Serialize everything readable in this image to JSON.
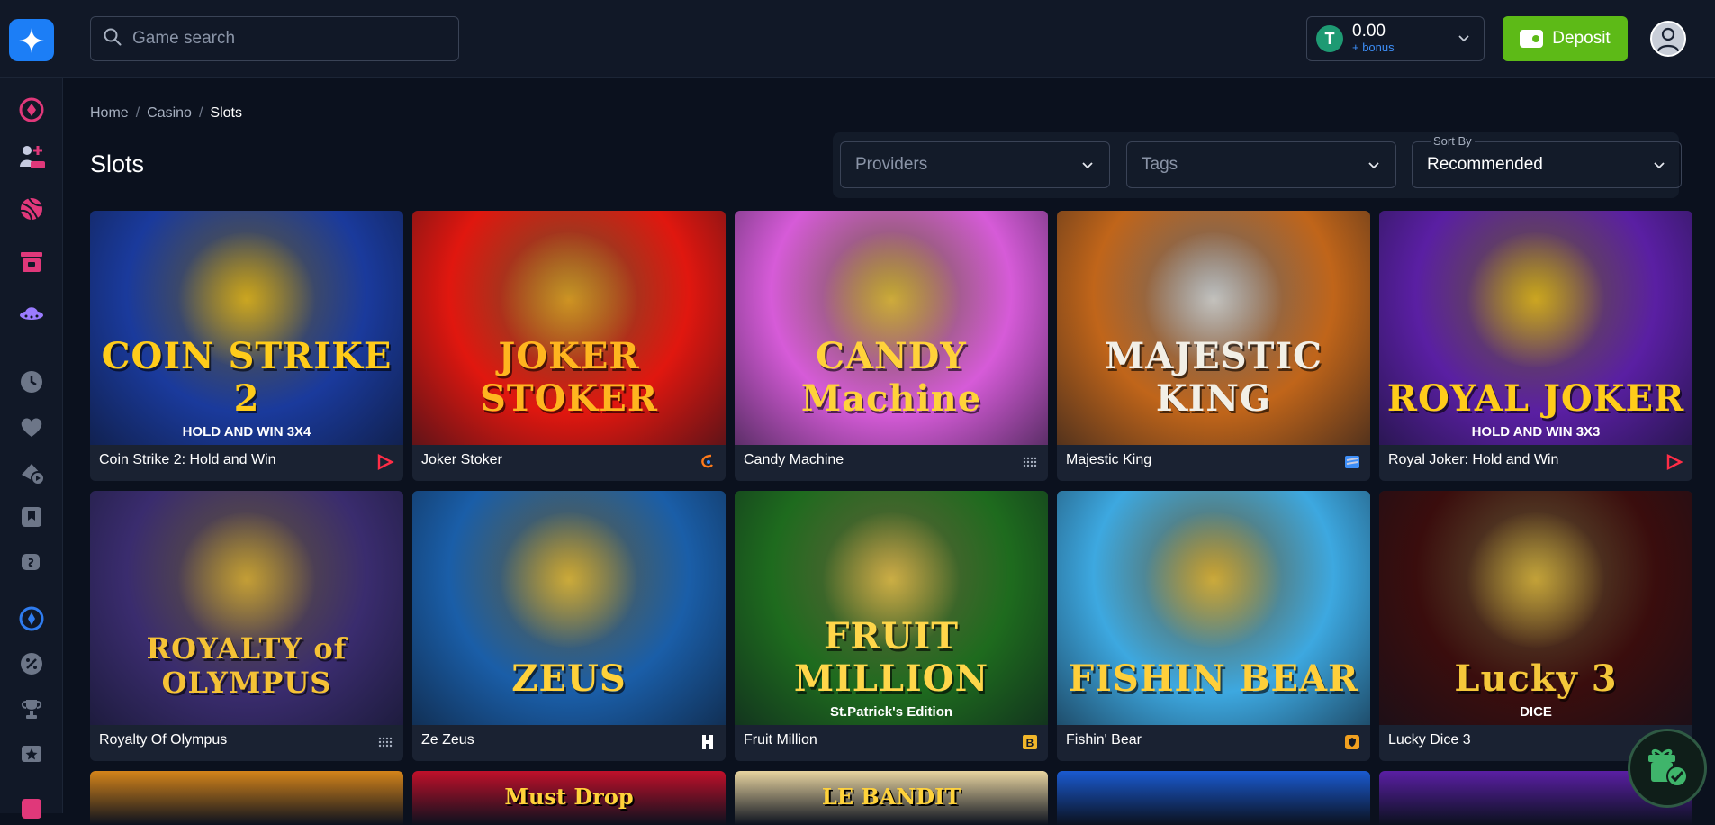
{
  "header": {
    "search_placeholder": "Game search",
    "balance": "0.00",
    "bonus_label": "+ bonus",
    "coin_symbol": "T",
    "deposit_label": "Deposit"
  },
  "breadcrumb": [
    {
      "label": "Home"
    },
    {
      "label": "Casino"
    },
    {
      "label": "Slots"
    }
  ],
  "page_title": "Slots",
  "filters": {
    "providers_placeholder": "Providers",
    "tags_placeholder": "Tags",
    "sort_label": "Sort By",
    "sort_value": "Recommended"
  },
  "games": [
    {
      "title": "Coin Strike 2: Hold and Win",
      "art_text": "COIN STRIKE 2",
      "art_sub": "HOLD AND WIN 3X4",
      "bg": "#1a3a9c",
      "accent": "#ffcc1a",
      "provider_icon": "play-arrow-icon"
    },
    {
      "title": "Joker Stoker",
      "art_text": "JOKER STOKER",
      "art_sub": "",
      "bg": "#e0170f",
      "accent": "#ffb51f",
      "provider_icon": "swirl-icon"
    },
    {
      "title": "Candy Machine",
      "art_text": "CANDY Machine",
      "art_sub": "",
      "bg": "#d65bd8",
      "accent": "#ffd23a",
      "provider_icon": "dots-grid-icon"
    },
    {
      "title": "Majestic King",
      "art_text": "MAJESTIC KING",
      "art_sub": "",
      "bg": "#c0651a",
      "accent": "#f2efe6",
      "provider_icon": "layers-icon"
    },
    {
      "title": "Royal Joker: Hold and Win",
      "art_text": "ROYAL JOKER",
      "art_sub": "HOLD AND WIN 3X3",
      "bg": "#5a1fa3",
      "accent": "#ffcc1a",
      "provider_icon": "play-arrow-icon"
    },
    {
      "title": "Royalty Of Olympus",
      "art_text": "ROYALTY of OLYMPUS",
      "art_sub": "",
      "bg": "#3a2c6e",
      "accent": "#f5c236",
      "provider_icon": "dots-grid-icon"
    },
    {
      "title": "Ze Zeus",
      "art_text": "ZEUS",
      "art_sub": "",
      "bg": "#1a5ea8",
      "accent": "#ffd13a",
      "provider_icon": "h-logo-icon"
    },
    {
      "title": "Fruit Million",
      "art_text": "FRUIT MILLION",
      "art_sub": "St.Patrick's Edition",
      "bg": "#1e6b1e",
      "accent": "#ffd64a",
      "provider_icon": "b-badge-icon"
    },
    {
      "title": "Fishin' Bear",
      "art_text": "FISHIN BEAR",
      "art_sub": "",
      "bg": "#3da8e0",
      "accent": "#ffcf3a",
      "provider_icon": "shield-badge-icon"
    },
    {
      "title": "Lucky Dice 3",
      "art_text": "Lucky 3",
      "art_sub": "DICE",
      "bg": "#3a0d0d",
      "accent": "#f4c73a",
      "provider_icon": ""
    }
  ],
  "partial_row": [
    {
      "art_text": "",
      "bg": "#d4841a"
    },
    {
      "art_text": "Must Drop",
      "bg": "#c0102a"
    },
    {
      "art_text": "LE BANDIT",
      "bg": "#e8d4a0"
    },
    {
      "art_text": "",
      "bg": "#1a5ad0"
    },
    {
      "art_text": "",
      "bg": "#5a1fa3"
    }
  ],
  "colors": {
    "background": "#0b111e",
    "accent_blue": "#1c7ef6",
    "deposit_green": "#5dba17"
  }
}
